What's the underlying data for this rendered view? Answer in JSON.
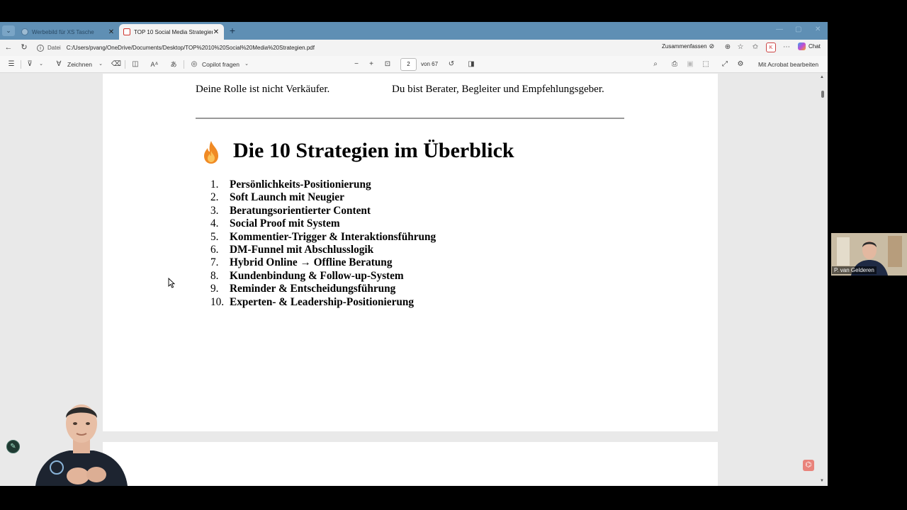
{
  "browser": {
    "tab_menu_icon": "chevron-down-icon",
    "tabs": [
      {
        "title": "Werbebild für XS Tasche",
        "active": false
      },
      {
        "title": "TOP 10 Social Media Strategien.pdf",
        "active": true
      }
    ],
    "address": {
      "scheme_label": "Datei",
      "url": "C:/Users/pvang/OneDrive/Documents/Desktop/TOP%2010%20Social%20Media%20Strategien.pdf",
      "summarize_label": "Zusammenfassen",
      "chat_label": "Chat"
    }
  },
  "pdf_toolbar": {
    "draw_label": "Zeichnen",
    "copilot_label": "Copilot fragen",
    "current_page": "2",
    "page_total": "von 67",
    "acrobat_label": "Mit Acrobat bearbeiten"
  },
  "document": {
    "role_left": "Deine Rolle ist nicht Verkäufer.",
    "role_right": "Du bist Berater, Begleiter und Empfehlungsgeber.",
    "heading_icon": "fire-icon",
    "heading": "Die 10 Strategien im Überblick",
    "strategies": [
      {
        "num": "1.",
        "text": "Persönlichkeits-Positionierung"
      },
      {
        "num": "2.",
        "text": "Soft Launch mit Neugier"
      },
      {
        "num": "3.",
        "text": "Beratungsorientierter Content"
      },
      {
        "num": "4.",
        "text": "Social Proof mit System"
      },
      {
        "num": "5.",
        "text": "Kommentier-Trigger & Interaktionsführung"
      },
      {
        "num": "6.",
        "text": "DM-Funnel mit Abschlusslogik"
      },
      {
        "num": "7.",
        "text": "Hybrid Online → Offline Beratung"
      },
      {
        "num": "8.",
        "text": "Kundenbindung & Follow-up-System"
      },
      {
        "num": "9.",
        "text": "Reminder & Entscheidungsführung"
      },
      {
        "num": "10.",
        "text": "Experten- & Leadership-Positionierung"
      }
    ]
  },
  "video_call": {
    "participant_name": "P. van Gelderen"
  },
  "colors": {
    "tabstrip": "#5f8fb4",
    "page_bg": "#ffffff",
    "viewer_bg": "#e9e9e9",
    "flame": "#f08a24"
  }
}
